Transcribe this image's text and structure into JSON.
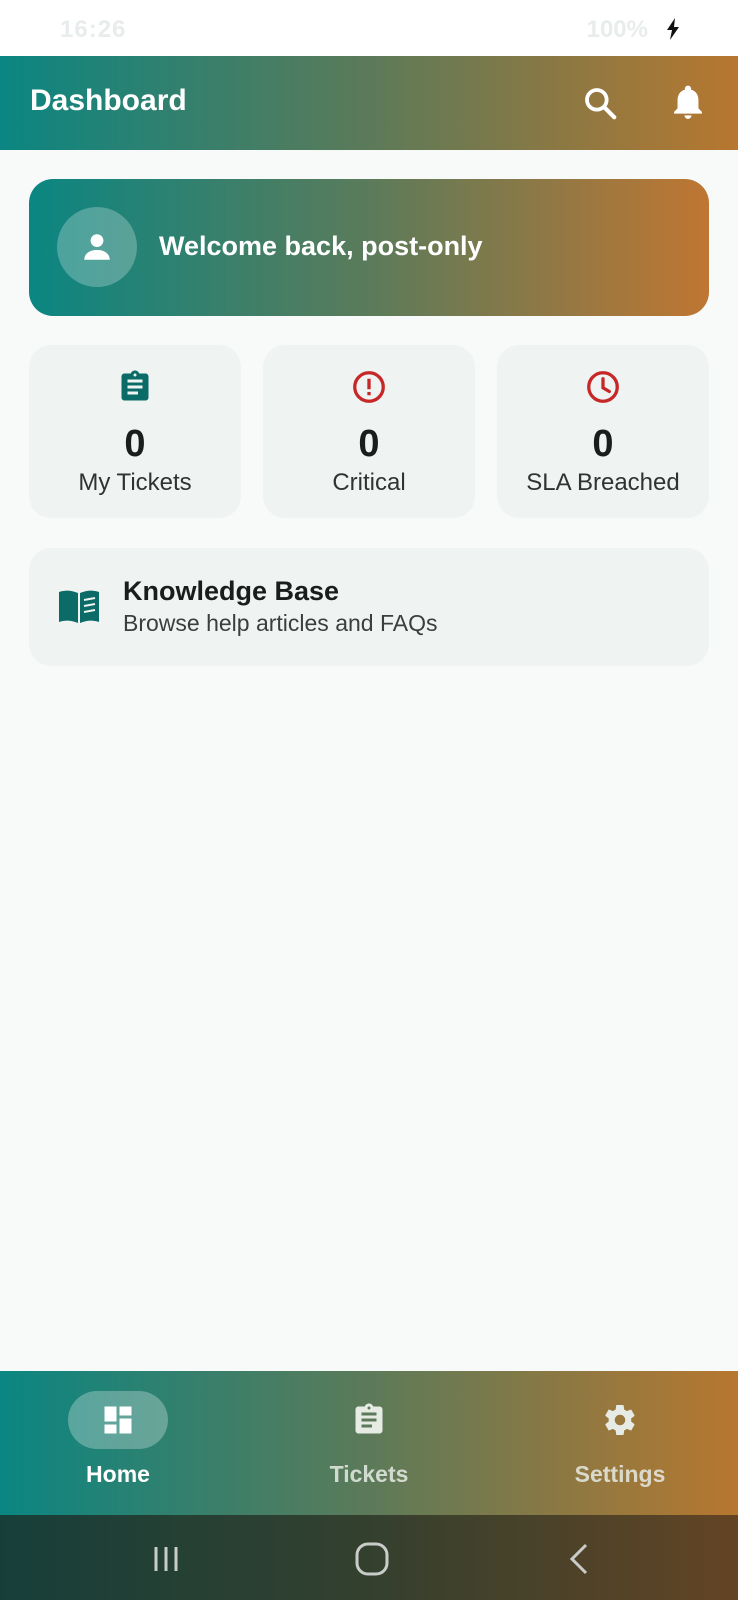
{
  "status_bar": {
    "time": "16:26",
    "battery": "100%"
  },
  "app_bar": {
    "title": "Dashboard"
  },
  "welcome": {
    "text": "Welcome back, post-only"
  },
  "stats": [
    {
      "value": "0",
      "label": "My Tickets",
      "icon": "clipboard-icon",
      "color": "#0b6b66"
    },
    {
      "value": "0",
      "label": "Critical",
      "icon": "alert-circle-icon",
      "color": "#c62828"
    },
    {
      "value": "0",
      "label": "SLA Breached",
      "icon": "clock-icon",
      "color": "#c62828"
    }
  ],
  "knowledge_base": {
    "title": "Knowledge Base",
    "subtitle": "Browse help articles and FAQs",
    "icon": "book-icon"
  },
  "bottom_nav": {
    "items": [
      {
        "label": "Home",
        "icon": "dashboard-icon",
        "active": true
      },
      {
        "label": "Tickets",
        "icon": "clipboard-icon",
        "active": false
      },
      {
        "label": "Settings",
        "icon": "gear-icon",
        "active": false
      }
    ]
  },
  "colors": {
    "gradient_start": "#0b8682",
    "gradient_end": "#b7772f",
    "card_bg": "#eff3f2",
    "accent_red": "#c62828"
  }
}
